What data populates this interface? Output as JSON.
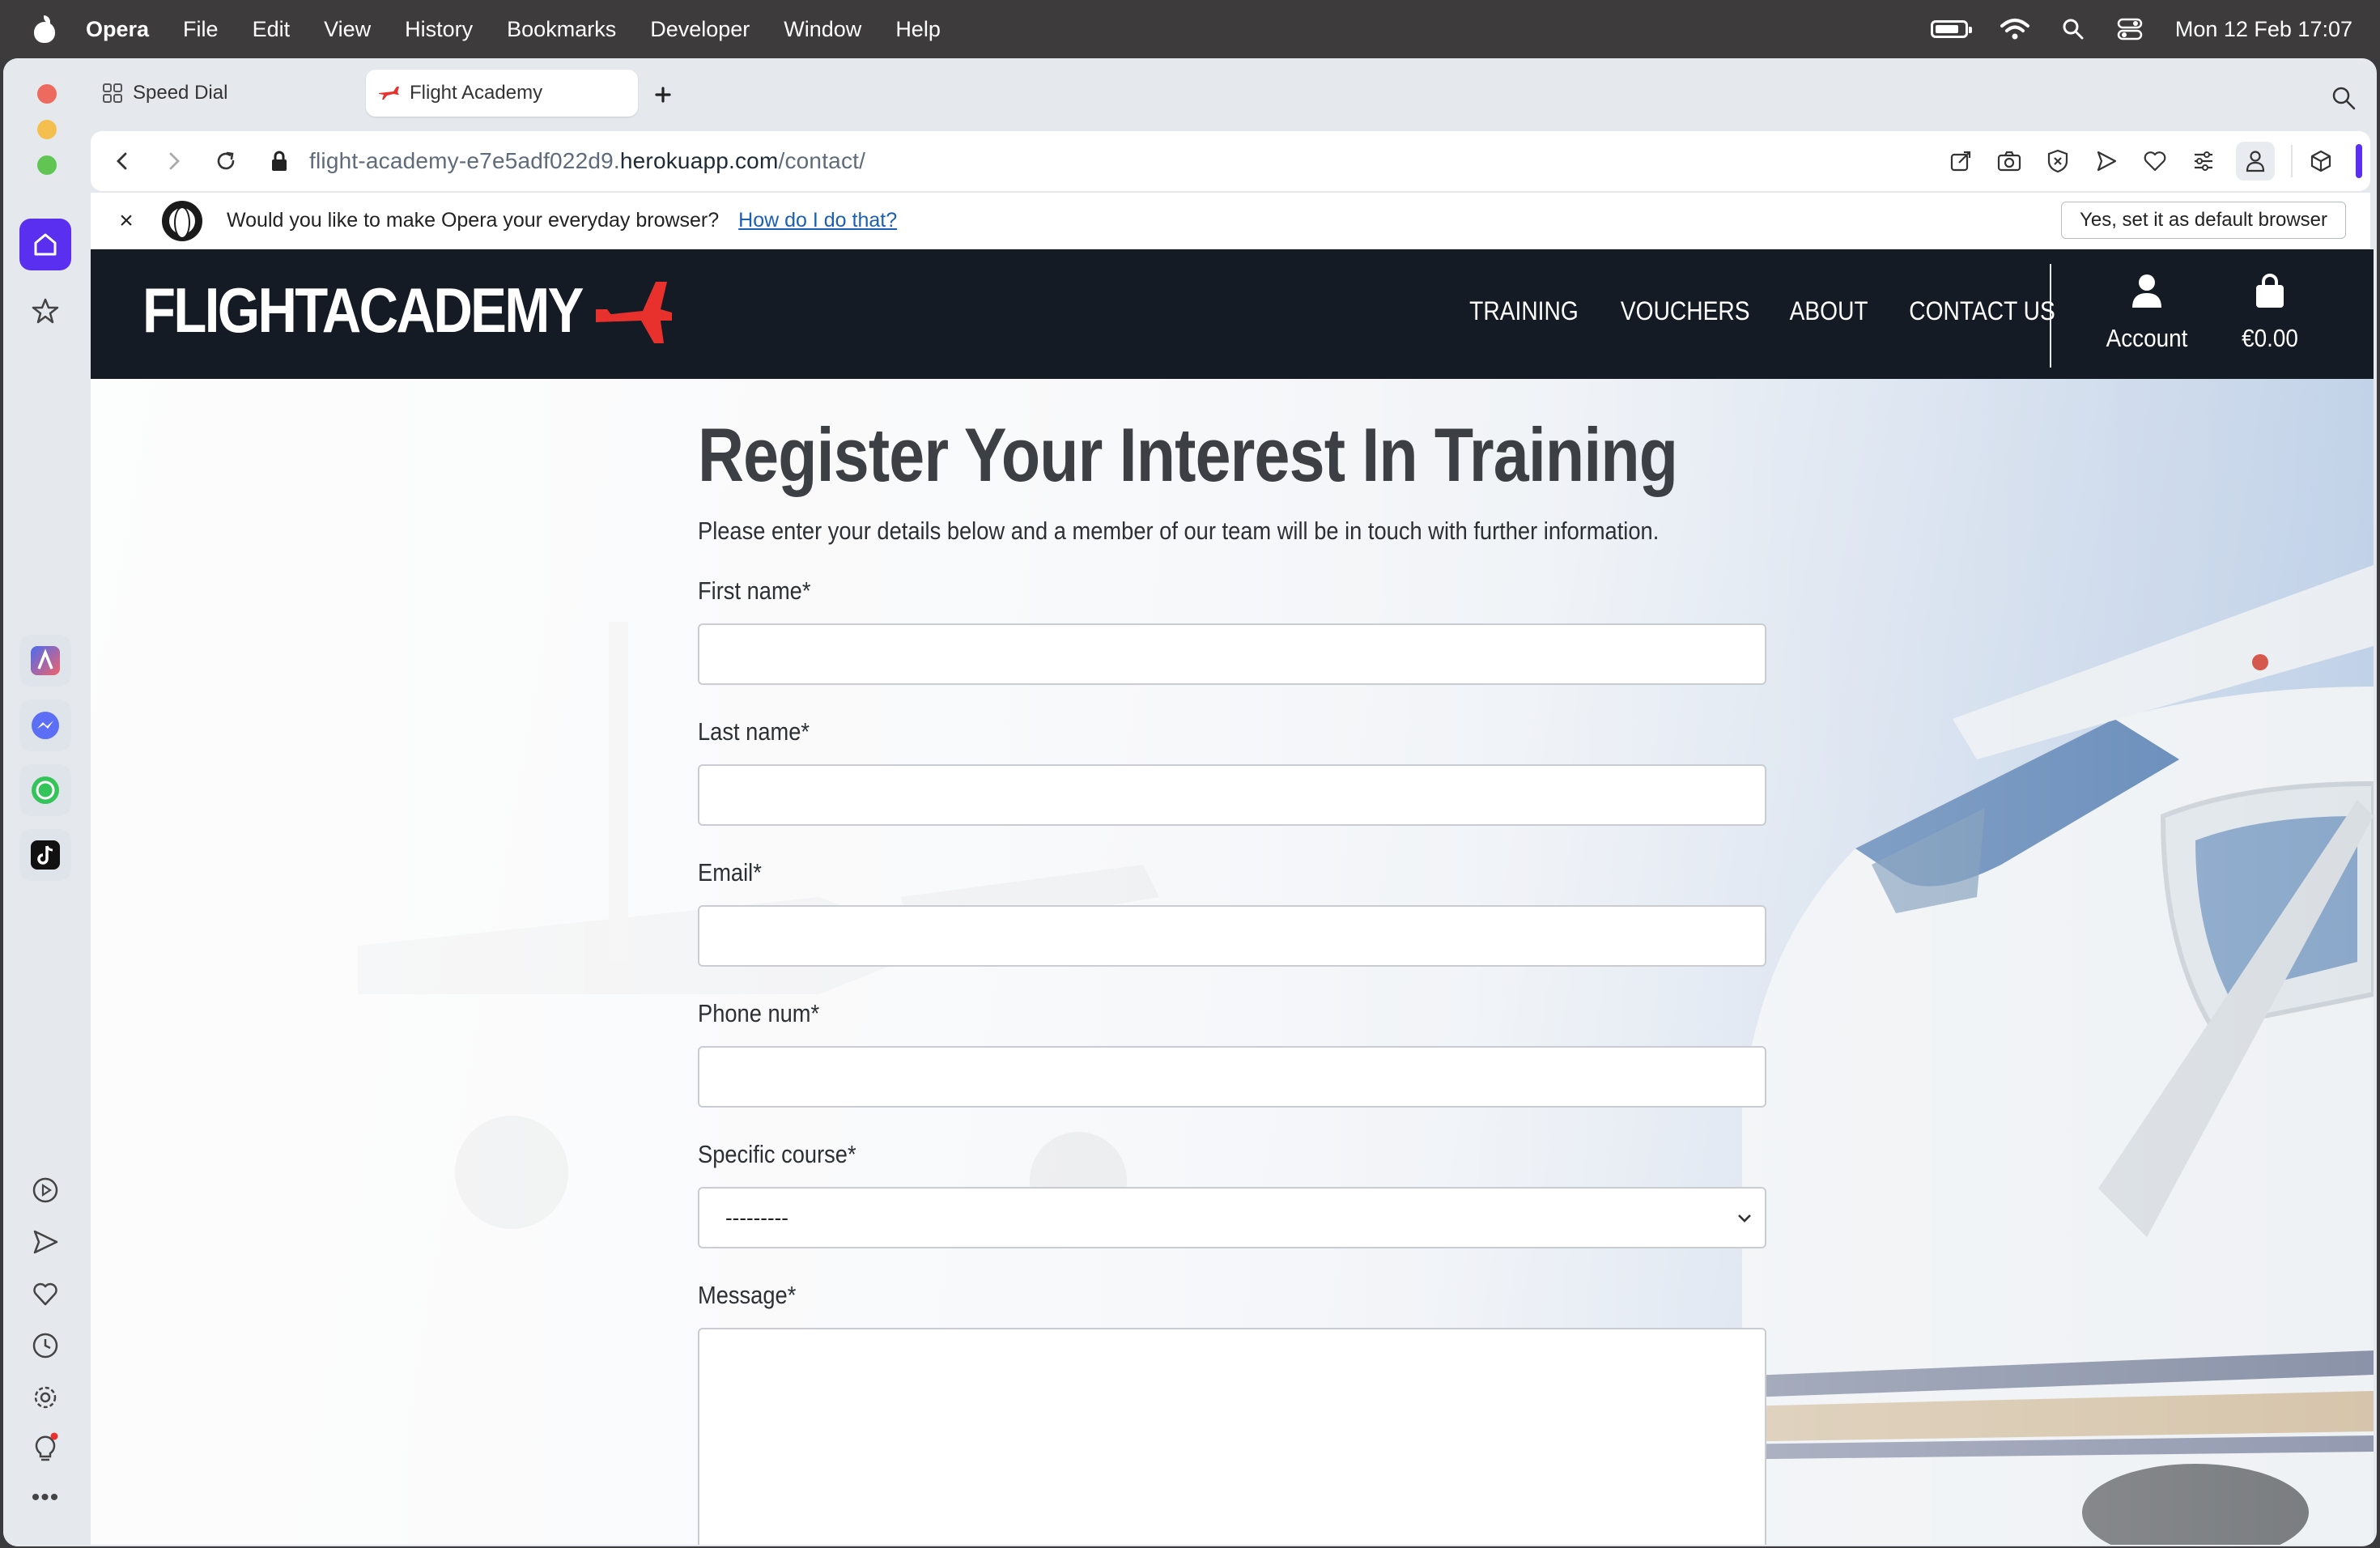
{
  "menubar": {
    "app": "Opera",
    "items": [
      "File",
      "Edit",
      "View",
      "History",
      "Bookmarks",
      "Developer",
      "Window",
      "Help"
    ],
    "datetime": "Mon 12 Feb  17:07"
  },
  "tabs": [
    {
      "label": "Speed Dial",
      "icon": "speed-dial-icon"
    },
    {
      "label": "Flight Academy",
      "icon": "plane-favicon"
    }
  ],
  "address": {
    "prefix": "flight-academy-e7e5adf022d9.",
    "host": "herokuapp.com",
    "path": "/contact/"
  },
  "infobar": {
    "message": "Would you like to make Opera your everyday browser?",
    "link": "How do I do that?",
    "button": "Yes, set it as default browser",
    "close": "×"
  },
  "site": {
    "logo": "FLIGHTACADEMY",
    "nav": [
      "TRAINING",
      "VOUCHERS",
      "ABOUT",
      "CONTACT US"
    ],
    "account_label": "Account",
    "basket_total": "€0.00"
  },
  "form": {
    "title": "Register Your Interest In Training",
    "subtitle": "Please enter your details below and a member of our team will be in touch with further information.",
    "fields": [
      {
        "label": "First name*"
      },
      {
        "label": "Last name*"
      },
      {
        "label": "Email*"
      },
      {
        "label": "Phone num*"
      }
    ],
    "course_label": "Specific course*",
    "course_selected": "---------",
    "message_label": "Message*"
  },
  "colors": {
    "header_bg": "#141b25",
    "brand_red": "#e8302d",
    "opera_accent": "#5a2ff0"
  }
}
